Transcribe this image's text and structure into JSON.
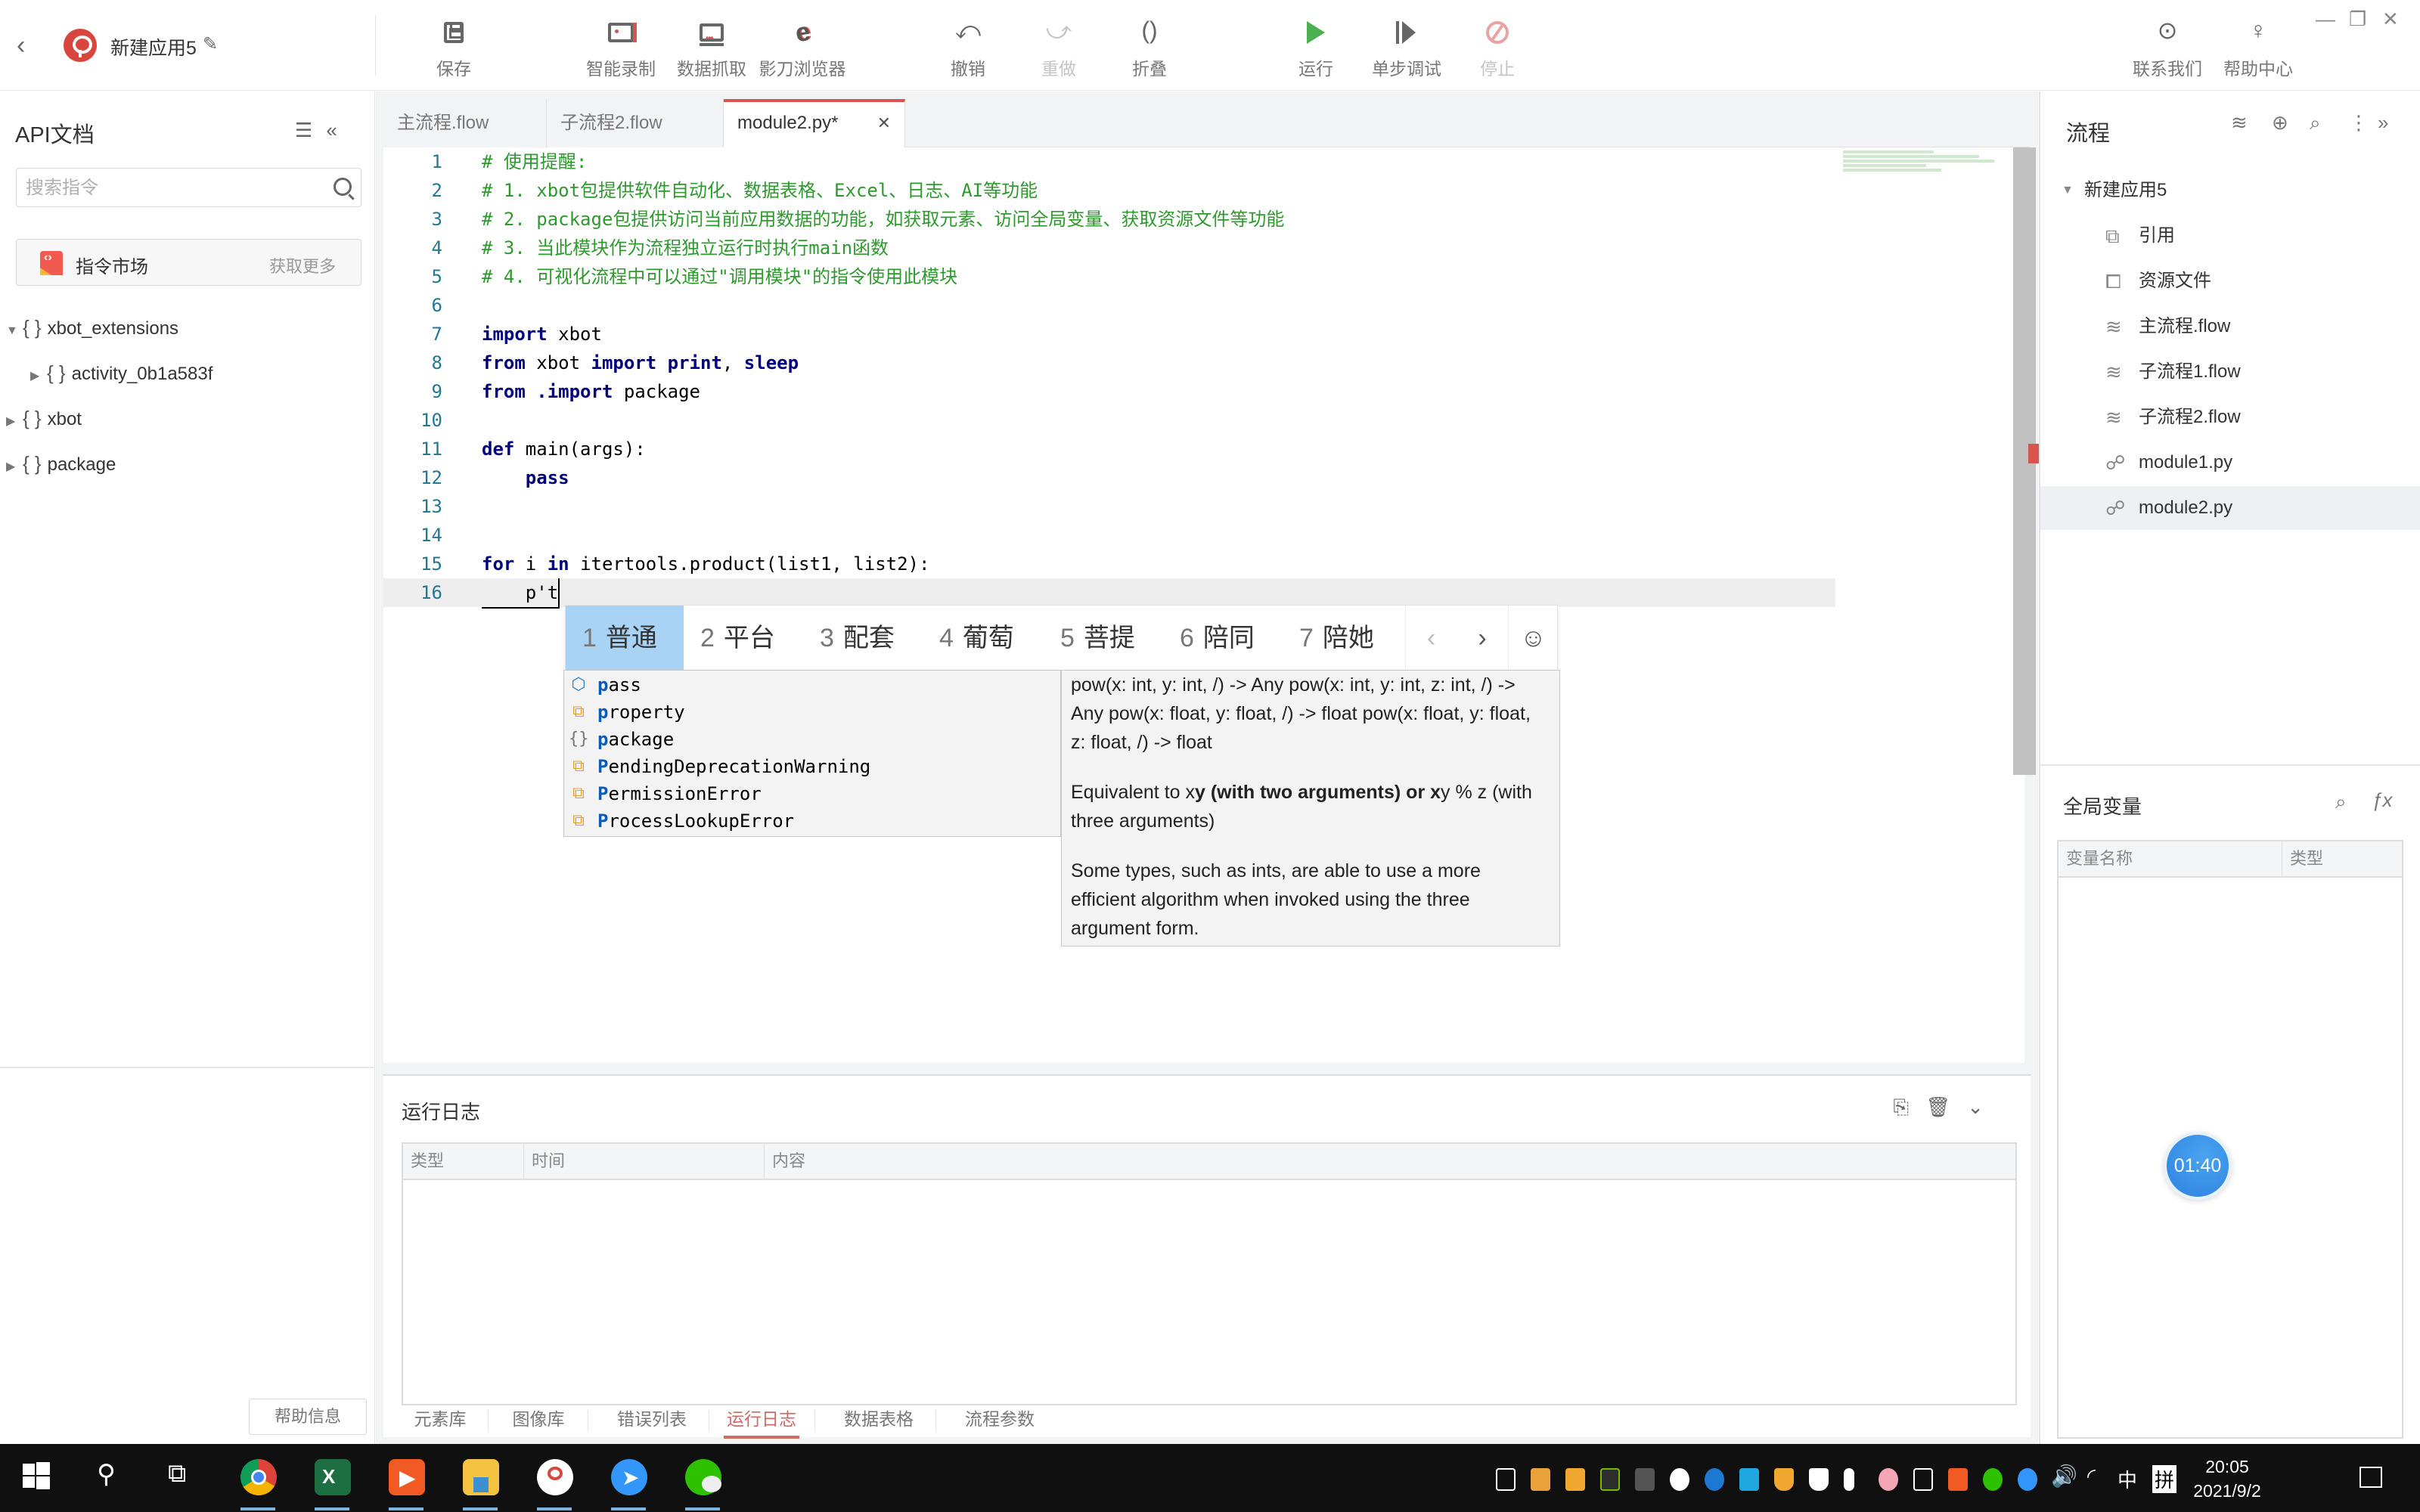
{
  "app": {
    "name": "新建应用5",
    "back_icon": "chevron-left-icon",
    "edit_icon": "pencil-icon"
  },
  "toolbar": {
    "save": "保存",
    "smart_record": "智能录制",
    "data_grab": "数据抓取",
    "browser": "影刀浏览器",
    "undo": "撤销",
    "redo": "重做",
    "fold": "折叠",
    "run": "运行",
    "step_debug": "单步调试",
    "stop": "停止",
    "contact_us": "联系我们",
    "help_center": "帮助中心",
    "run_color": "#4caf50",
    "stop_color": "#e8a4a2"
  },
  "window_controls": {
    "minimize": "—",
    "restore": "❐",
    "close": "✕"
  },
  "left_panel": {
    "title": "API文档",
    "search_placeholder": "搜索指令",
    "market_label": "指令市场",
    "market_more": "获取更多",
    "tree": [
      {
        "label": "xbot_extensions",
        "expanded": true,
        "level": 0
      },
      {
        "label": "activity_0b1a583f",
        "expanded": false,
        "level": 1
      },
      {
        "label": "xbot",
        "expanded": false,
        "level": 0
      },
      {
        "label": "package",
        "expanded": false,
        "level": 0
      }
    ],
    "help_button": "帮助信息"
  },
  "tabs": [
    {
      "label": "主流程.flow",
      "active": false
    },
    {
      "label": "子流程2.flow",
      "active": false
    },
    {
      "label": "module2.py*",
      "active": true,
      "close": "✕"
    }
  ],
  "editor": {
    "accent": "#d9534f",
    "lines": [
      {
        "n": "1",
        "text": "# 使用提醒:"
      },
      {
        "n": "2",
        "text": "# 1. xbot包提供软件自动化、数据表格、Excel、日志、AI等功能"
      },
      {
        "n": "3",
        "text": "# 2. package包提供访问当前应用数据的功能，如获取元素、访问全局变量、获取资源文件等功能"
      },
      {
        "n": "4",
        "text": "# 3. 当此模块作为流程独立运行时执行main函数"
      },
      {
        "n": "5",
        "text": "# 4. 可视化流程中可以通过\"调用模块\"的指令使用此模块"
      },
      {
        "n": "6",
        "text": ""
      },
      {
        "n": "7",
        "kw1": "import",
        "rest1": " xbot"
      },
      {
        "n": "8",
        "kw1": "from",
        "rest1": " xbot ",
        "kw2": "import print",
        "rest2": ", ",
        "kw3": "sleep"
      },
      {
        "n": "9",
        "kw1": "from",
        "rest1": " ",
        "kw2": ".import",
        "rest2": " package"
      },
      {
        "n": "10",
        "text": ""
      },
      {
        "n": "11",
        "kw1": "def",
        "rest1": " main(args):"
      },
      {
        "n": "12",
        "kw1": "    pass"
      },
      {
        "n": "13",
        "text": ""
      },
      {
        "n": "14",
        "text": ""
      },
      {
        "n": "15",
        "kw1": "for",
        "rest1": " i ",
        "kw2": "in",
        "rest2": " itertools.product(list1, list2):"
      },
      {
        "n": "16",
        "text": "    p't"
      }
    ]
  },
  "ime": {
    "candidates": [
      {
        "num": "1",
        "text": "普通"
      },
      {
        "num": "2",
        "text": "平台"
      },
      {
        "num": "3",
        "text": "配套"
      },
      {
        "num": "4",
        "text": "葡萄"
      },
      {
        "num": "5",
        "text": "菩提"
      },
      {
        "num": "6",
        "text": "陪同"
      },
      {
        "num": "7",
        "text": "陪她"
      }
    ],
    "prev": "‹",
    "next": "›",
    "emoji": "☺"
  },
  "autocomplete": {
    "items": [
      {
        "icon": "keyword-icon",
        "first": "p",
        "rest": "ass"
      },
      {
        "icon": "class-icon",
        "first": "p",
        "rest": "roperty"
      },
      {
        "icon": "module-icon",
        "first": "p",
        "rest": "ackage"
      },
      {
        "icon": "class-icon",
        "first": "P",
        "rest": "endingDeprecationWarning"
      },
      {
        "icon": "class-icon",
        "first": "P",
        "rest": "ermissionError"
      },
      {
        "icon": "class-icon",
        "first": "P",
        "rest": "rocessLookupError"
      }
    ],
    "doc": {
      "signature": "pow(x: int, y: int, /) -> Any pow(x: int, y: int, z: int, /) -> Any pow(x: float, y: float, /) -> float pow(x: float, y: float, z: float, /) -> float",
      "p2_a": "Equivalent to x",
      "p2_b": "y (with two arguments) or x",
      "p2_c": "y % z (with three arguments)",
      "p3": "Some types, such as ints, are able to use a more efficient algorithm when invoked using the three argument form."
    }
  },
  "log_panel": {
    "title": "运行日志",
    "columns": [
      "类型",
      "时间",
      "内容"
    ],
    "rows": []
  },
  "bottom_tabs": [
    {
      "label": "元素库",
      "active": false
    },
    {
      "label": "图像库",
      "active": false
    },
    {
      "label": "错误列表",
      "active": false
    },
    {
      "label": "运行日志",
      "active": true
    },
    {
      "label": "数据表格",
      "active": false
    },
    {
      "label": "流程参数",
      "active": false
    }
  ],
  "right_panel": {
    "title": "流程",
    "project": "新建应用5",
    "items": [
      {
        "icon": "reference-icon",
        "label": "引用",
        "selected": false
      },
      {
        "icon": "resource-file-icon",
        "label": "资源文件",
        "selected": false
      },
      {
        "icon": "flow-layers-icon",
        "label": "主流程.flow",
        "selected": false
      },
      {
        "icon": "flow-layers-icon",
        "label": "子流程1.flow",
        "selected": false
      },
      {
        "icon": "flow-layers-icon",
        "label": "子流程2.flow",
        "selected": false
      },
      {
        "icon": "python-icon",
        "label": "module1.py",
        "selected": false
      },
      {
        "icon": "python-icon",
        "label": "module2.py",
        "selected": true
      }
    ],
    "globals_title": "全局变量",
    "globals_columns": [
      "变量名称",
      "类型"
    ],
    "globals_rows": []
  },
  "timer": "01:40",
  "taskbar": {
    "apps": [
      "chrome",
      "excel",
      "kuaishou",
      "file-explorer",
      "yingdao",
      "dingtalk",
      "wechat"
    ],
    "clock_time": "20:05",
    "clock_date": "2021/9/2",
    "ime_lang": "中",
    "ime_mode": "拼"
  }
}
